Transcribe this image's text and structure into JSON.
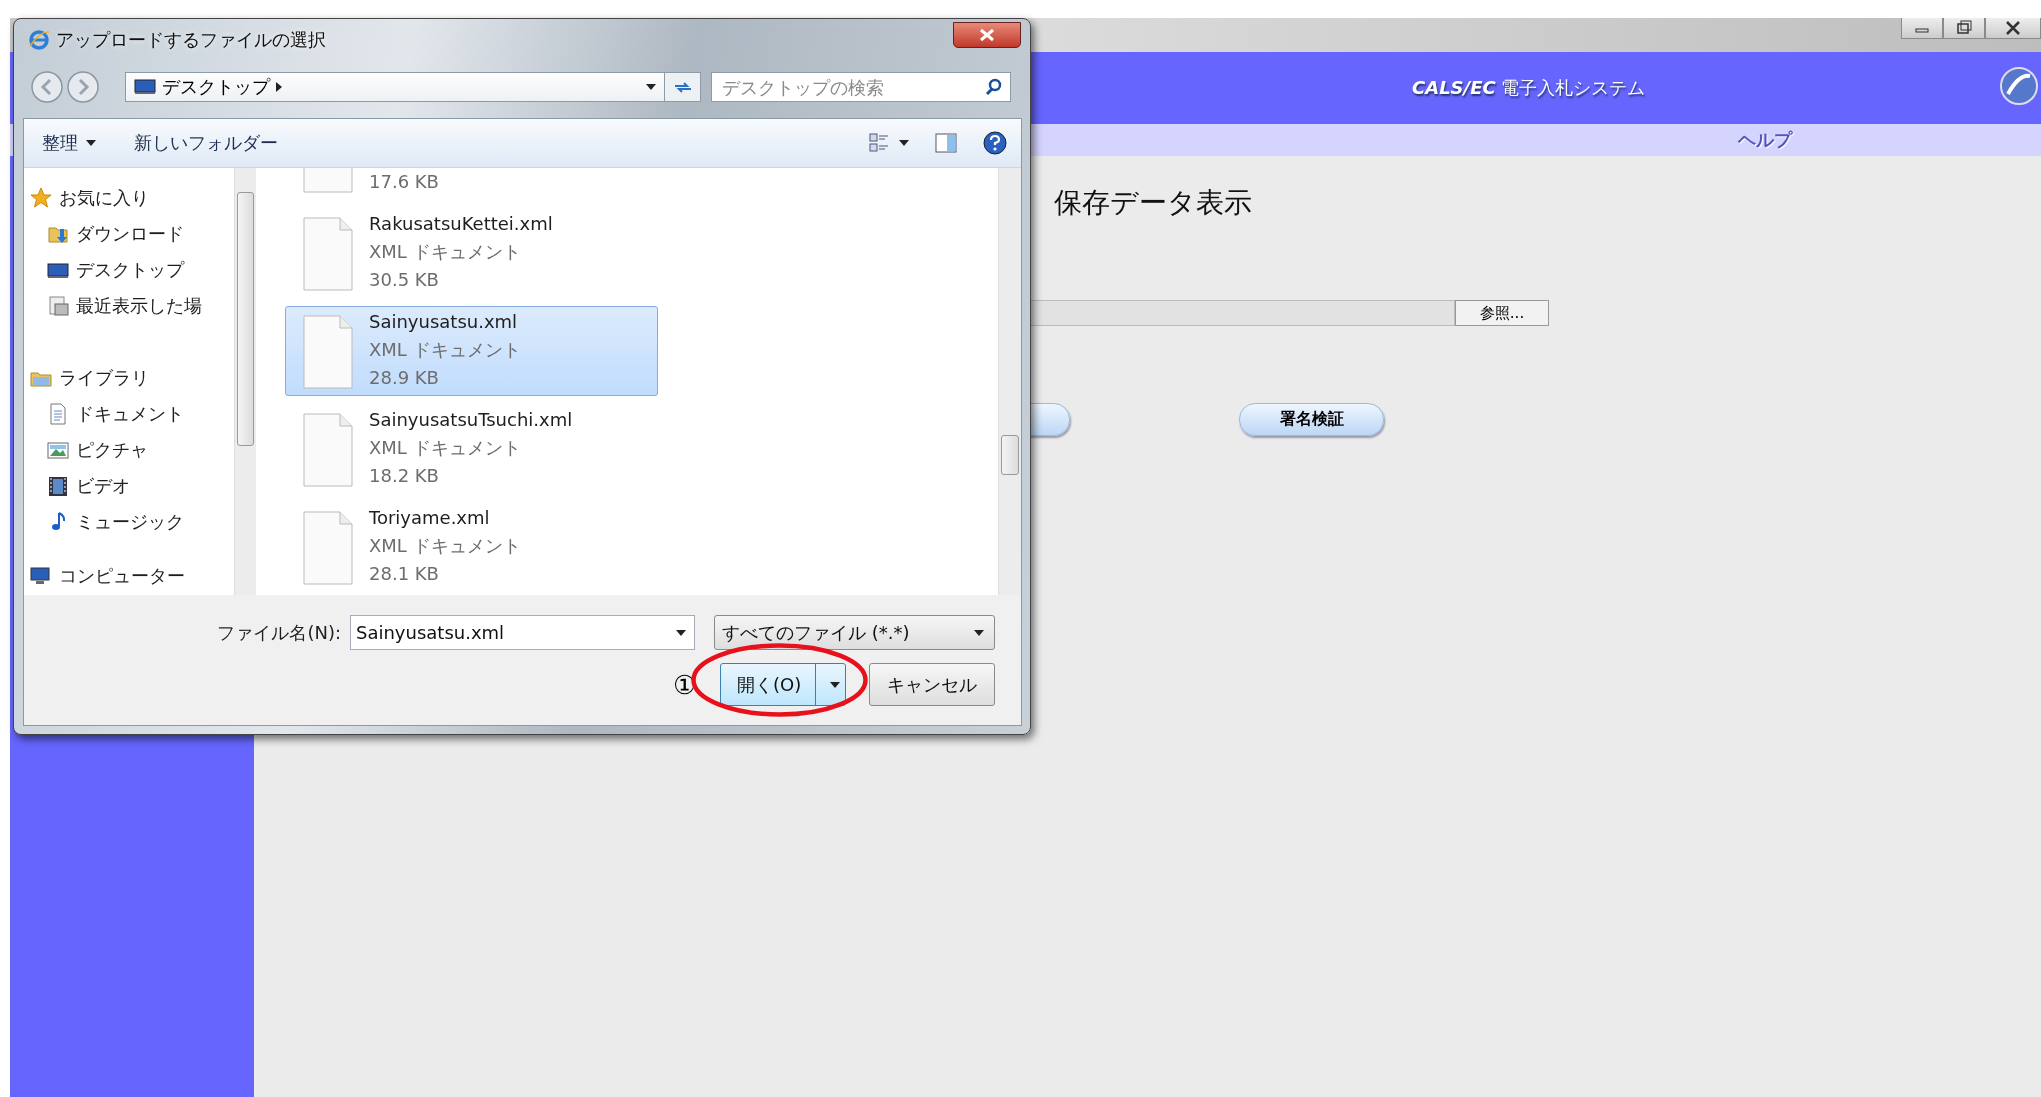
{
  "browser": {
    "header_title": "**CALS/EC** 電子入札システム",
    "menu": [
      {
        "label": "ヘルプ"
      }
    ],
    "page_title": "保存データ表示",
    "browse_button": "参照...",
    "verify_button": "署名検証"
  },
  "dialog": {
    "title": "アップロードするファイルの選択",
    "address": "デスクトップ",
    "search": {
      "placeholder": "デスクトップの検索"
    },
    "toolbar": [
      {
        "label": "整理",
        "kind": "dropdown"
      },
      {
        "label": "新しいフォルダー",
        "kind": "plain"
      }
    ],
    "nav": [
      {
        "label": "お気に入り",
        "kind": "star",
        "children": [
          {
            "label": "ダウンロード",
            "kind": "download"
          },
          {
            "label": "デスクトップ",
            "kind": "desktop"
          },
          {
            "label": "最近表示した場",
            "kind": "recent"
          }
        ]
      },
      {
        "label": "ライブラリ",
        "kind": "library",
        "children": [
          {
            "label": "ドキュメント",
            "kind": "document"
          },
          {
            "label": "ピクチャ",
            "kind": "picture"
          },
          {
            "label": "ビデオ",
            "kind": "video"
          },
          {
            "label": "ミュージック",
            "kind": "music"
          }
        ]
      },
      {
        "label": "コンピューター",
        "kind": "computer"
      }
    ],
    "files": [
      {
        "size": "17.6 KB",
        "selected": false
      },
      {
        "name": "RakusatsuKettei.xml",
        "type": "XML ドキュメント",
        "size": "30.5 KB",
        "selected": false
      },
      {
        "name": "Sainyusatsu.xml",
        "type": "XML ドキュメント",
        "size": "28.9 KB",
        "selected": true
      },
      {
        "name": "SainyusatsuTsuchi.xml",
        "type": "XML ドキュメント",
        "size": "18.2 KB",
        "selected": false
      },
      {
        "name": "Toriyame.xml",
        "type": "XML ドキュメント",
        "size": "28.1 KB",
        "selected": false
      }
    ],
    "filename_label": "ファイル名(N):",
    "filename": "Sainyusatsu.xml",
    "filter": "すべてのファイル (*.*)",
    "open_button": "開く(O)",
    "cancel_button": "キャンセル"
  },
  "annotation": {
    "marker": "①"
  }
}
